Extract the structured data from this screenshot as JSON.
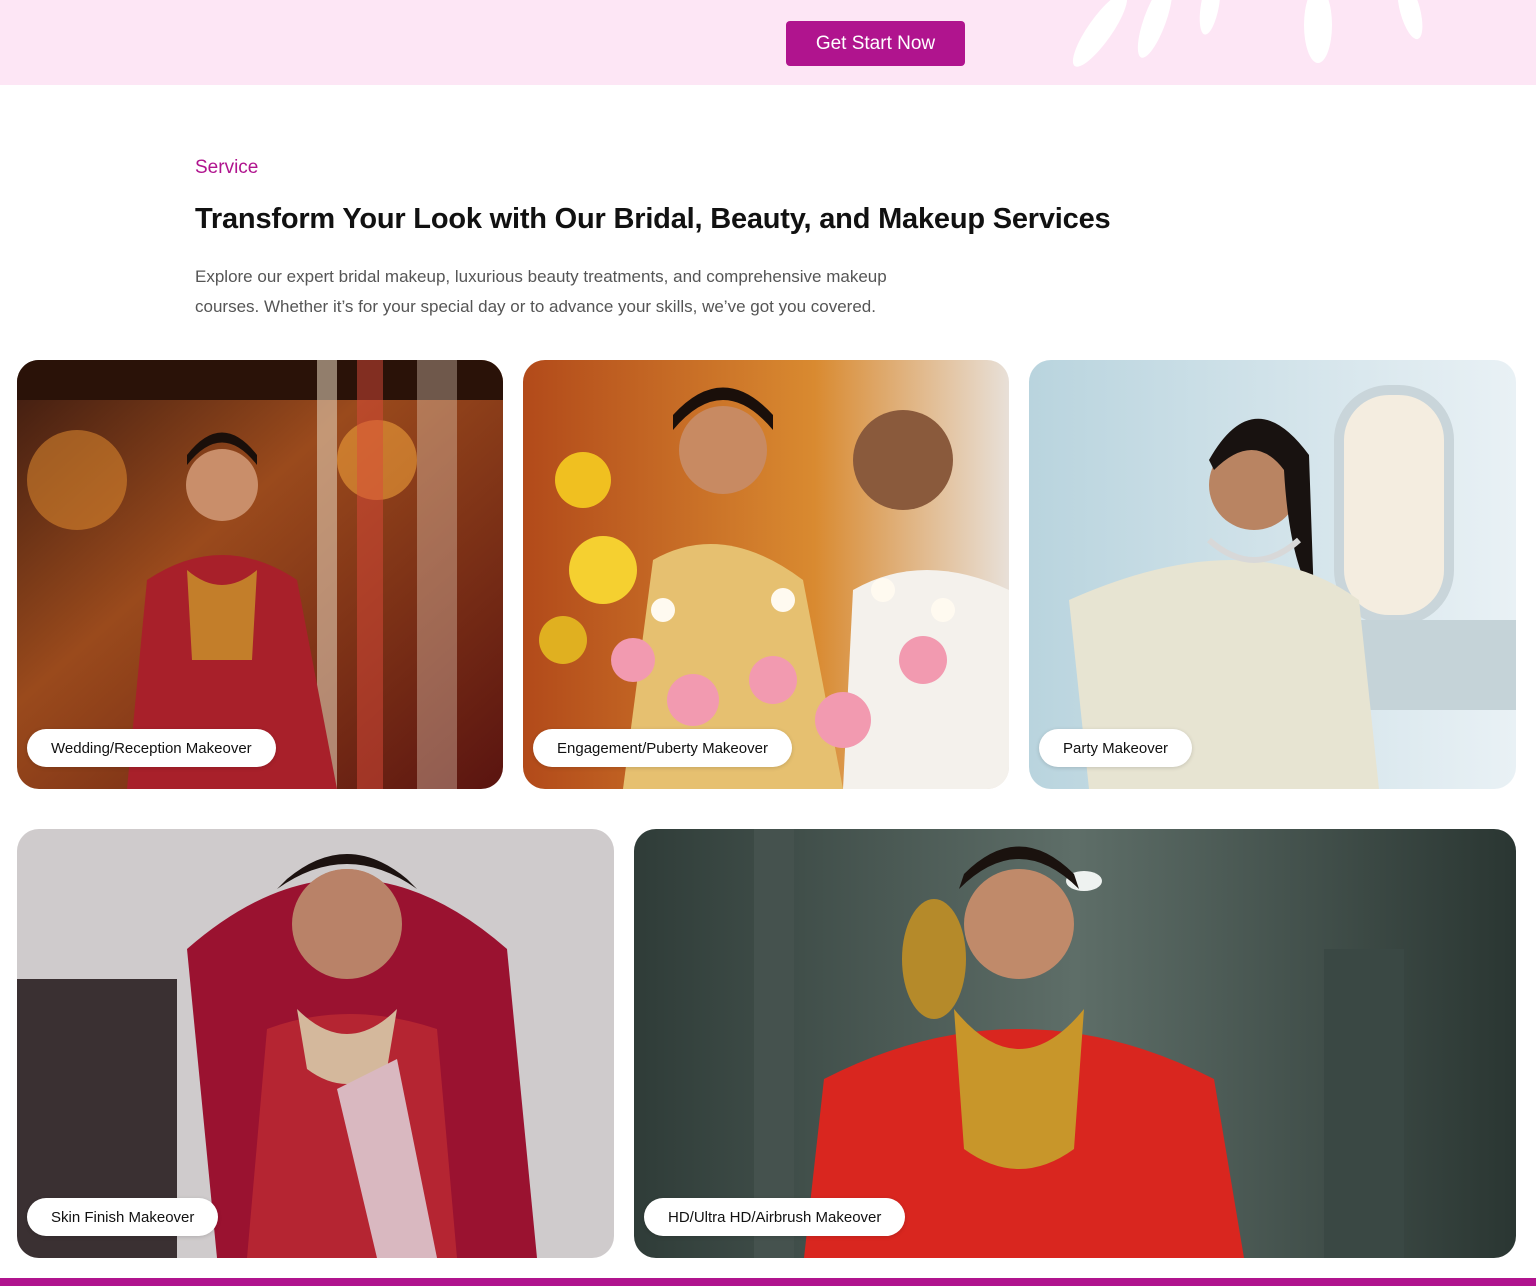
{
  "hero": {
    "cta_label": "Get Start Now"
  },
  "service": {
    "eyebrow": "Service",
    "title": "Transform Your Look with Our Bridal, Beauty, and Makeup Services",
    "description": "Explore our expert bridal makeup, luxurious beauty treatments, and comprehensive makeup courses. Whether it’s for your special day or to advance your skills, we’ve got you covered.",
    "cards": [
      {
        "label": "Wedding/Reception Makeover"
      },
      {
        "label": "Engagement/Puberty Makeover"
      },
      {
        "label": "Party Makeover"
      },
      {
        "label": "Skin Finish Makeover"
      },
      {
        "label": "HD/Ultra HD/Airbrush Makeover"
      }
    ]
  },
  "colors": {
    "accent": "#b0148e",
    "hero_background": "#fde6f5"
  }
}
